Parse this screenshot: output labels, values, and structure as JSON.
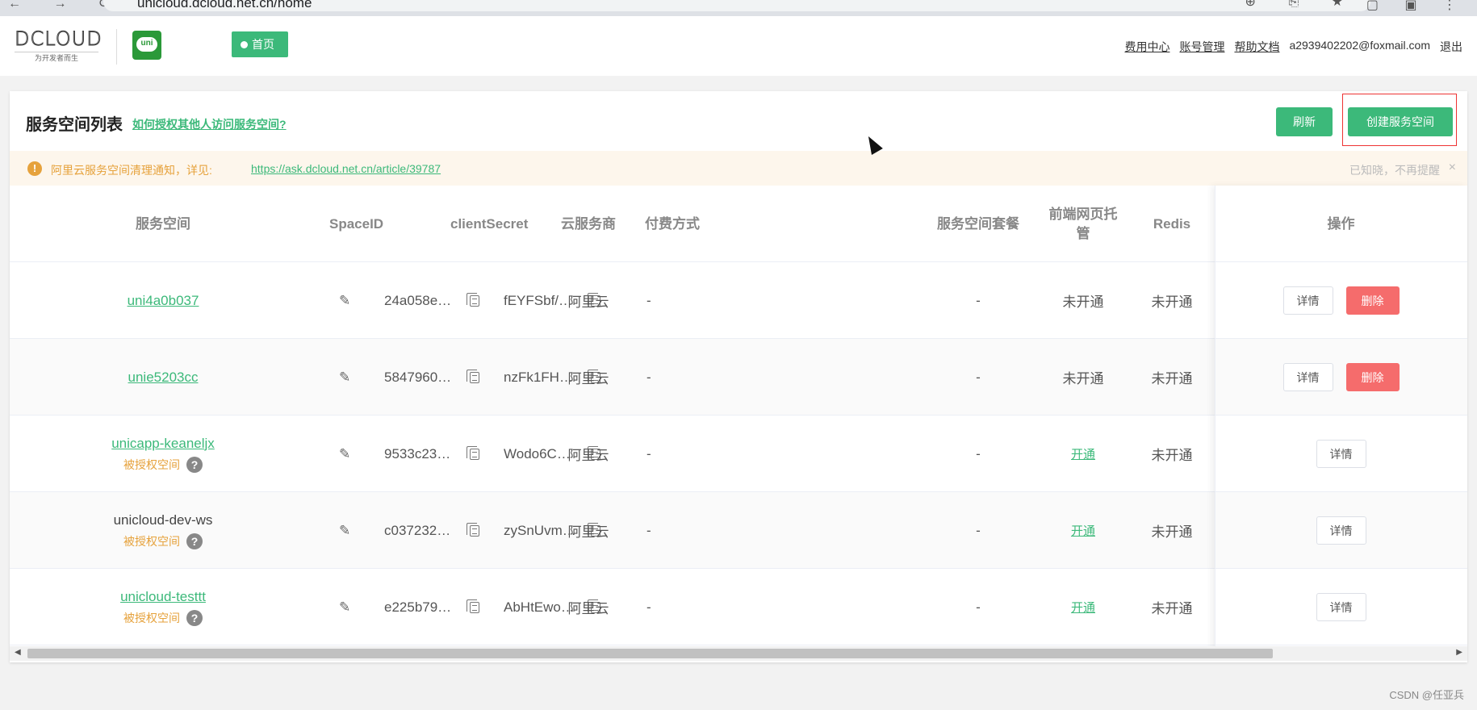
{
  "browser": {
    "url": "unicloud.dcloud.net.cn/home",
    "nav_glyphs": "← → ⟳",
    "addr_glyphs": "⊕ ⎘ ★",
    "window_glyphs": "▢ ▣ ⋮"
  },
  "header": {
    "logo_text": "DCLOUD",
    "logo_slogan": "为开发者而生",
    "uni_logo_text": "uni",
    "home_label": "首页",
    "links": [
      "费用中心",
      "账号管理",
      "帮助文档"
    ],
    "account_email": "a2939402202@foxmail.com",
    "logout_label": "退出"
  },
  "page": {
    "title": "服务空间列表",
    "help_link": "如何授权其他人访问服务空间?",
    "refresh_label": "刷新",
    "create_label": "创建服务空间"
  },
  "notice": {
    "icon": "!",
    "text": "阿里云服务空间清理通知，详见:",
    "link": "https://ask.dcloud.net.cn/article/39787",
    "dismiss": "已知晓，不再提醒",
    "close": "×"
  },
  "table": {
    "headers": {
      "space": "服务空间",
      "spaceid": "SpaceID",
      "secret": "clientSecret",
      "provider": "云服务商",
      "payment": "付费方式",
      "package": "服务空间套餐",
      "hosting": "前端网页托管",
      "redis": "Redis",
      "actions": "操作"
    },
    "glyphs": {
      "edit": "✎",
      "question": "?"
    },
    "auth_tag": "被授权空间",
    "detail_label": "详情",
    "delete_label": "删除",
    "rows": [
      {
        "name": "uni4a0b037",
        "linked": true,
        "authorized": false,
        "spaceid": "24a058e…",
        "secret": "fEYFSbf/…",
        "provider": "阿里云",
        "payment": "-",
        "package": "-",
        "hosting": "未开通",
        "hosting_open": false,
        "redis": "未开通",
        "deletable": true
      },
      {
        "name": "unie5203cc",
        "linked": true,
        "authorized": false,
        "spaceid": "5847960…",
        "secret": "nzFk1FH…",
        "provider": "阿里云",
        "payment": "-",
        "package": "-",
        "hosting": "未开通",
        "hosting_open": false,
        "redis": "未开通",
        "deletable": true
      },
      {
        "name": "unicapp-keaneljx",
        "linked": true,
        "authorized": true,
        "spaceid": "9533c23…",
        "secret": "Wodo6C…",
        "provider": "阿里云",
        "payment": "-",
        "package": "-",
        "hosting": "开通",
        "hosting_open": true,
        "redis": "未开通",
        "deletable": false
      },
      {
        "name": "unicloud-dev-ws",
        "linked": false,
        "authorized": true,
        "spaceid": "c037232…",
        "secret": "zySnUvm…",
        "provider": "阿里云",
        "payment": "-",
        "package": "-",
        "hosting": "开通",
        "hosting_open": true,
        "redis": "未开通",
        "deletable": false
      },
      {
        "name": "unicloud-testtt",
        "linked": true,
        "authorized": true,
        "spaceid": "e225b79…",
        "secret": "AbHtEwo…",
        "provider": "阿里云",
        "payment": "-",
        "package": "-",
        "hosting": "开通",
        "hosting_open": true,
        "redis": "未开通",
        "deletable": false
      }
    ]
  },
  "scrollbar": {
    "left_arrow": "◀",
    "right_arrow": "▶"
  },
  "watermark": "CSDN @任亚兵",
  "colors": {
    "accent": "#3cb97a",
    "danger": "#f56c6c",
    "warning": "#e6a23c"
  }
}
